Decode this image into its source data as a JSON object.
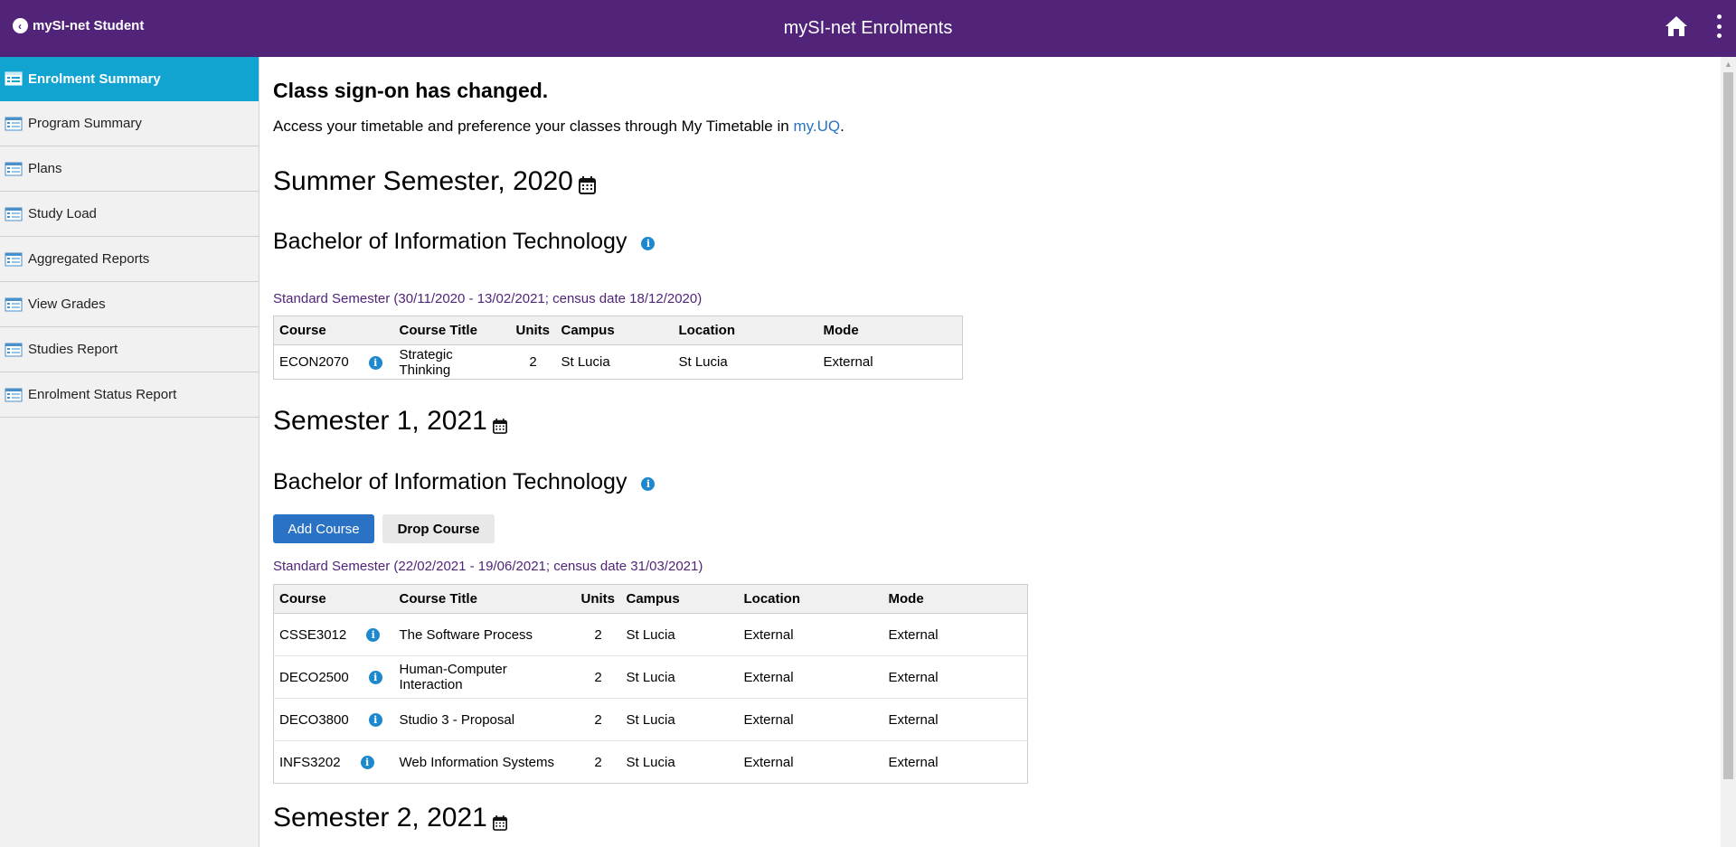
{
  "header": {
    "back_label": "mySI-net Student",
    "title": "mySI-net Enrolments",
    "icons": [
      "chevron-left-icon",
      "home-icon",
      "more-vertical-icon"
    ],
    "bar_color": "#51247a"
  },
  "sidebar": {
    "active_color": "#12a4d1",
    "items": [
      {
        "label": "Enrolment Summary",
        "active": true
      },
      {
        "label": "Program Summary"
      },
      {
        "label": "Plans"
      },
      {
        "label": "Study Load"
      },
      {
        "label": "Aggregated Reports"
      },
      {
        "label": "View Grades"
      },
      {
        "label": "Studies Report"
      },
      {
        "label": "Enrolment Status Report"
      }
    ]
  },
  "notice": {
    "title": "Class sign-on has changed.",
    "text_before": "Access your timetable and preference your classes through My Timetable in ",
    "link": "my.UQ",
    "text_after": "."
  },
  "columns": [
    "Course",
    "Course Title",
    "Units",
    "Campus",
    "Location",
    "Mode"
  ],
  "semesters": [
    {
      "title": "Summer Semester, 2020",
      "program": "Bachelor of Information Technology",
      "period": "Standard Semester (30/11/2020 - 13/02/2021; census date 18/12/2020)",
      "courses": [
        {
          "code": "ECON2070",
          "title": "Strategic Thinking",
          "units": "2",
          "campus": "St Lucia",
          "location": "St Lucia",
          "mode": "External"
        }
      ]
    },
    {
      "title": "Semester 1, 2021",
      "program": "Bachelor of Information Technology",
      "add_button": "Add Course",
      "drop_button": "Drop Course",
      "period": "Standard Semester (22/02/2021 - 19/06/2021; census date 31/03/2021)",
      "courses": [
        {
          "code": "CSSE3012",
          "title": "The Software Process",
          "units": "2",
          "campus": "St Lucia",
          "location": "External",
          "mode": "External"
        },
        {
          "code": "DECO2500",
          "title": "Human-Computer Interaction",
          "units": "2",
          "campus": "St Lucia",
          "location": "External",
          "mode": "External"
        },
        {
          "code": "DECO3800",
          "title": "Studio 3 - Proposal",
          "units": "2",
          "campus": "St Lucia",
          "location": "External",
          "mode": "External"
        },
        {
          "code": "INFS3202",
          "title": "Web Information Systems",
          "units": "2",
          "campus": "St Lucia",
          "location": "External",
          "mode": "External"
        }
      ]
    },
    {
      "title": "Semester 2, 2021"
    }
  ]
}
